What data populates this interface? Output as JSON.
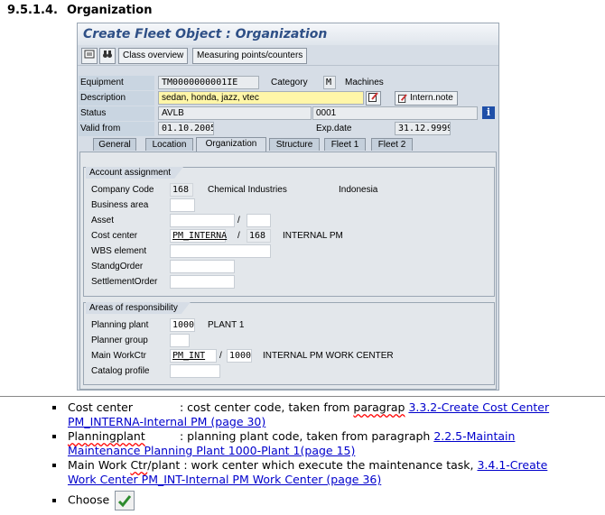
{
  "doc": {
    "section_number": "9.5.1.4.",
    "section_title": "Organization"
  },
  "window": {
    "title": "Create Fleet Object : Organization"
  },
  "toolbar": {
    "btn_class_overview": "Class overview",
    "btn_measuring_points": "Measuring points/counters"
  },
  "header": {
    "equipment_label": "Equipment",
    "equipment_value": "TM0000000001IE",
    "category_label": "Category",
    "category_value": "M",
    "category_text": "Machines",
    "description_label": "Description",
    "description_value": "sedan, honda, jazz, vtec",
    "intern_note_label": "Intern.note",
    "status_label": "Status",
    "status_value": "AVLB",
    "status_code": "0001",
    "valid_from_label": "Valid from",
    "valid_from_value": "01.10.2005",
    "exp_date_label": "Exp.date",
    "exp_date_value": "31.12.9999"
  },
  "tabs": [
    "General",
    "Location",
    "Organization",
    "Structure",
    "Fleet 1",
    "Fleet 2"
  ],
  "account_assignment": {
    "title": "Account assignment",
    "company_code_label": "Company Code",
    "company_code_value": "168",
    "company_name": "Chemical Industries",
    "company_country": "Indonesia",
    "business_area_label": "Business area",
    "asset_label": "Asset",
    "asset_sep": "/",
    "cost_center_label": "Cost center",
    "cost_center_value": "PM_INTERNA",
    "cost_center_sep": "/",
    "cost_center_co": "168",
    "cost_center_text": "INTERNAL PM",
    "wbs_label": "WBS element",
    "standg_label": "StandgOrder",
    "settlement_label": "SettlementOrder"
  },
  "areas": {
    "title": "Areas of responsibility",
    "planning_plant_label": "Planning plant",
    "planning_plant_value": "1000",
    "planning_plant_text": "PLANT 1",
    "planner_group_label": "Planner group",
    "main_workctr_label": "Main WorkCtr",
    "main_workctr_value": "PM_INT",
    "main_workctr_sep": "/",
    "main_workctr_plant": "1000",
    "main_workctr_text": "INTERNAL PM WORK CENTER",
    "catalog_profile_label": "Catalog profile"
  },
  "bullets": {
    "b1_term": "Cost center",
    "b1_text": ": cost center code, taken from",
    "b1_word": "paragrap",
    "b1_link": "3.3.2-Create Cost Center PM_INTERNA-Internal PM (page 30)",
    "b2_term": "Planningplant",
    "b2_text": ": planning plant code, taken from paragraph",
    "b2_link": "2.2.5-Maintain Maintenance Planning Plant 1000-Plant 1(page 15)",
    "b3_term_a": "Main Work",
    "b3_term_b": "Ctr",
    "b3_term_c": "/plant",
    "b3_text": ": work center which execute the maintenance task,",
    "b3_link": "3.4.1-Create Work Center PM_INT-Internal PM Work Center (page 36)",
    "b4_text": "Choose"
  }
}
